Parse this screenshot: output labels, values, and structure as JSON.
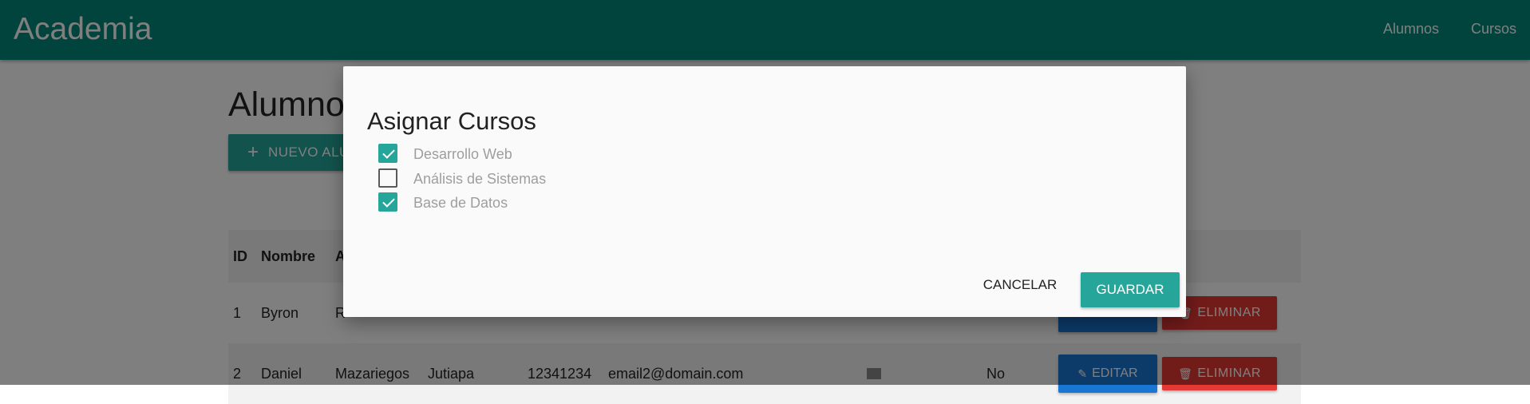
{
  "navbar": {
    "brand": "Academia",
    "links": [
      "Alumnos",
      "Cursos"
    ],
    "color": "#00897b"
  },
  "page": {
    "title": "Alumnos",
    "new_button": {
      "icon": "plus-icon",
      "label": "NUEVO ALUMNO"
    }
  },
  "table": {
    "headers": [
      "ID",
      "Nombre",
      "A"
    ],
    "rows": [
      {
        "id": "1",
        "nombre": "Byron",
        "apellido": "R",
        "ciudad": "",
        "telefono": "",
        "email": "",
        "activo": ""
      },
      {
        "id": "2",
        "nombre": "Daniel",
        "apellido": "Mazariegos",
        "ciudad": "Jutiapa",
        "telefono": "12341234",
        "email": "email2@domain.com",
        "activo": "No"
      }
    ],
    "edit_label": "EDITAR",
    "delete_label": "ELIMINAR"
  },
  "modal": {
    "title": "Asignar Cursos",
    "courses": [
      {
        "label": "Desarrollo Web",
        "checked": true
      },
      {
        "label": "Análisis de Sistemas",
        "checked": false
      },
      {
        "label": "Base de Datos",
        "checked": true
      }
    ],
    "cancel_label": "CANCELAR",
    "save_label": "GUARDAR",
    "accent": "#26a69a"
  },
  "colors": {
    "primary": "#00897b",
    "accent": "#26a69a",
    "edit": "#1976d2",
    "delete": "#e53935"
  }
}
